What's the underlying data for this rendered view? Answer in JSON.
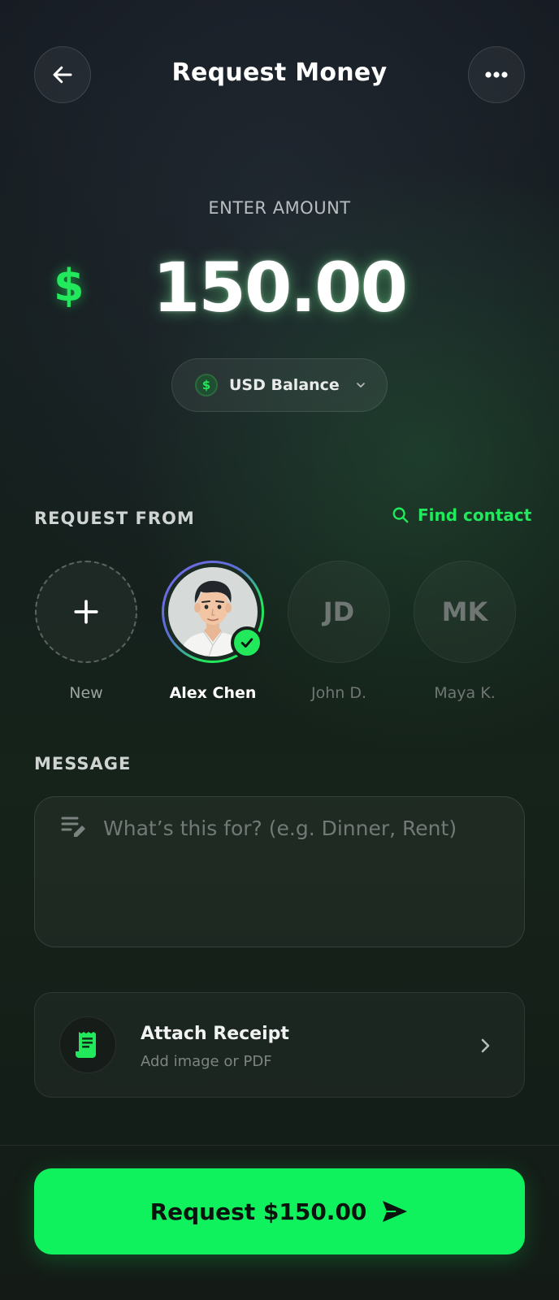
{
  "header": {
    "title": "Request Money",
    "back_icon": "arrow-left-icon",
    "more_icon": "more-horizontal-icon"
  },
  "amount": {
    "label": "ENTER AMOUNT",
    "currency_symbol": "$",
    "value": "150.00",
    "balance_coin": "$",
    "balance_label": "USD Balance"
  },
  "request_from": {
    "label": "REQUEST FROM",
    "find_contact": "Find contact",
    "contacts": [
      {
        "name": "New",
        "type": "add"
      },
      {
        "name": "Alex Chen",
        "type": "avatar",
        "selected": true
      },
      {
        "name": "John D.",
        "initials": "JD"
      },
      {
        "name": "Maya K.",
        "initials": "MK"
      }
    ]
  },
  "message": {
    "label": "MESSAGE",
    "placeholder": "What’s this for? (e.g. Dinner, Rent)",
    "value": ""
  },
  "attach": {
    "title": "Attach Receipt",
    "subtitle": "Add image or PDF"
  },
  "cta": {
    "label": "Request $150.00"
  },
  "colors": {
    "accent": "#0ff25d",
    "background": "#141a18"
  }
}
